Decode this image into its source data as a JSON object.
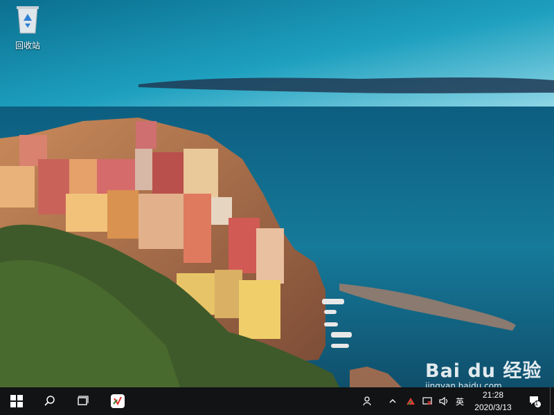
{
  "desktop": {
    "icons": [
      {
        "label": "回收站",
        "icon": "recycle-bin-icon"
      }
    ],
    "watermark": {
      "logo": "Bai du 经验",
      "url": "jingyan.baidu.com"
    }
  },
  "taskbar": {
    "start_icon": "windows-logo-icon",
    "search_icon": "search-icon",
    "task_view_icon": "task-view-icon",
    "pinned": [
      {
        "icon": "app-icon"
      }
    ],
    "tray": {
      "people_icon": "people-icon",
      "chevron_icon": "chevron-up-icon",
      "ime_label": "英",
      "clock_time": "21:28",
      "clock_date": "2020/3/13",
      "notification_count": "1"
    }
  },
  "colors": {
    "taskbar": "#111315",
    "sky_top": "#0e6f8f",
    "sea": "#0f5f82"
  }
}
